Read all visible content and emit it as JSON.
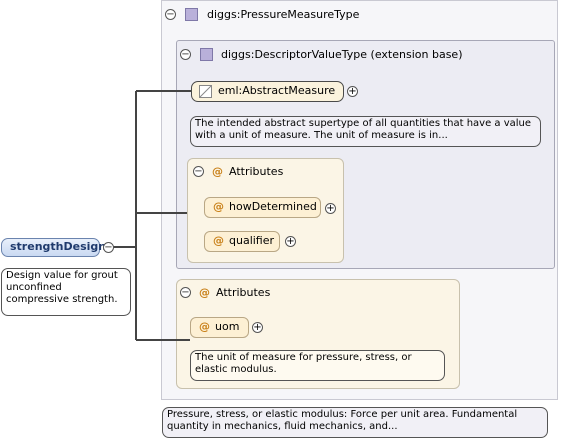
{
  "root": {
    "name": "strengthDesign",
    "annotation": "Design value for grout unconfined compressive strength."
  },
  "pressure_type": {
    "name": "diggs:PressureMeasureType",
    "annotation": "Pressure, stress, or elastic modulus: Force per unit area. Fundamental quantity in mechanics, fluid mechanics, and..."
  },
  "descriptor_type": {
    "name": "diggs:DescriptorValueType (extension base)"
  },
  "abstract_measure": {
    "name": "eml:AbstractMeasure",
    "annotation": "The intended abstract supertype of all quantities that have a value with a unit of measure. The unit of measure is in..."
  },
  "descriptor_attributes": {
    "title": "Attributes",
    "items": [
      "howDetermined",
      "qualifier"
    ]
  },
  "pressure_attributes": {
    "title": "Attributes",
    "uom": "uom",
    "uom_annotation": "The unit of measure for pressure, stress, or elastic modulus."
  },
  "symbols": {
    "collapse": "−",
    "expand": "+",
    "attribute": "@"
  },
  "colors": {
    "root_text": "#1f3a6c",
    "attribute_symbol": "#c9811a",
    "type_icon": "#b9b0da"
  }
}
